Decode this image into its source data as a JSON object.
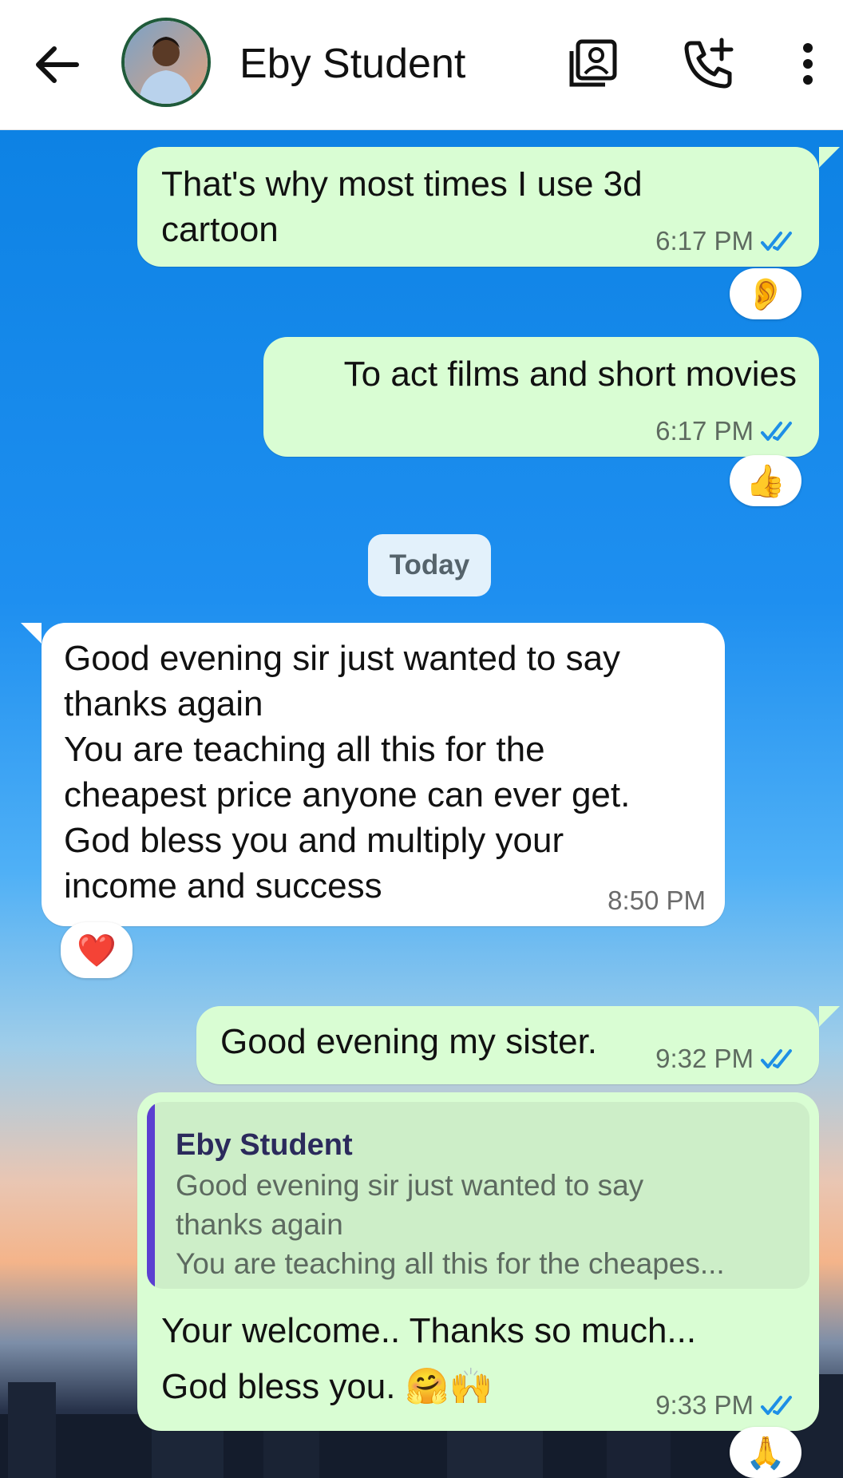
{
  "header": {
    "contact_name": "Eby Student",
    "icons": [
      "back-arrow-icon",
      "contact-card-icon",
      "add-call-icon",
      "more-vert-icon"
    ]
  },
  "colors": {
    "outgoing_bubble": "#d9fdd3",
    "incoming_bubble": "#ffffff",
    "read_ticks": "#1e8fe6",
    "quote_bar": "#5b3fd1"
  },
  "messages": [
    {
      "direction": "out",
      "text": "That's why most times I use 3d\ncartoon",
      "time": "6:17 PM",
      "status": "read",
      "reaction": "👂"
    },
    {
      "direction": "out",
      "text": "To act films and short movies",
      "time": "6:17 PM",
      "status": "read",
      "reaction": "👍"
    },
    {
      "direction": "in",
      "text": "Good evening sir just wanted to say\nthanks again\nYou are teaching all this for the\ncheapest price anyone can ever get.\nGod bless you and multiply your\nincome and success",
      "time": "8:50 PM",
      "reaction": "❤️"
    },
    {
      "direction": "out",
      "text": "Good evening my sister.",
      "time": "9:32 PM",
      "status": "read"
    },
    {
      "direction": "out",
      "text": "Your welcome.. Thanks so much...\nGod bless you. 🤗🙌",
      "time": "9:33 PM",
      "status": "read",
      "reaction": "🙏",
      "quoted": {
        "author": "Eby Student",
        "lines": [
          "Good evening sir just wanted to say",
          "thanks again",
          "You are teaching all this for the cheapes..."
        ]
      }
    }
  ],
  "date_divider": "Today"
}
